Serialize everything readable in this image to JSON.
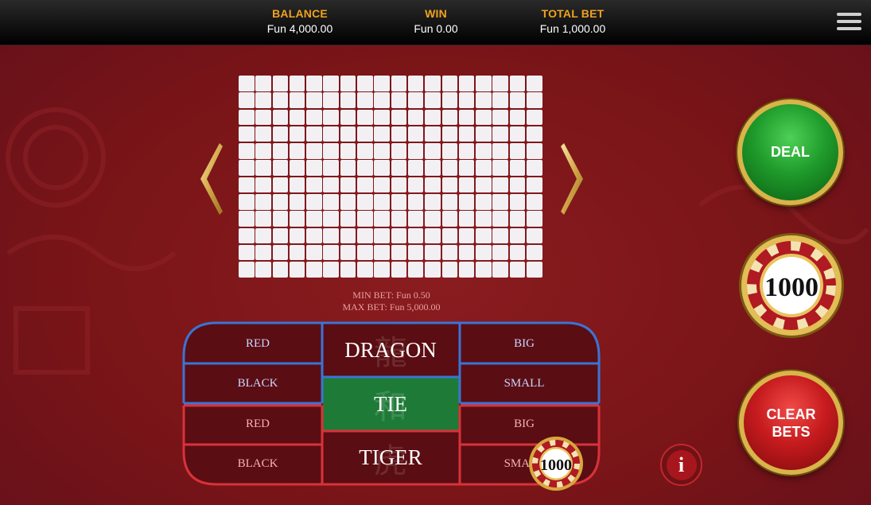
{
  "header": {
    "balance_label": "BALANCE",
    "balance_value": "Fun 4,000.00",
    "win_label": "WIN",
    "win_value": "Fun 0.00",
    "total_bet_label": "TOTAL BET",
    "total_bet_value": "Fun 1,000.00"
  },
  "roadmap": {
    "columns": 18,
    "rows": 12
  },
  "limits": {
    "min_bet": "MIN BET: Fun 0.50",
    "max_bet": "MAX BET: Fun 5,000.00"
  },
  "table": {
    "dragon_red": "RED",
    "dragon_black": "BLACK",
    "dragon_big": "BIG",
    "dragon_small": "SMALL",
    "tiger_red": "RED",
    "tiger_black": "BLACK",
    "tiger_big": "BIG",
    "tiger_small": "SMALL",
    "dragon": "DRAGON",
    "tie": "TIE",
    "tiger": "TIGER",
    "dragon_glyph": "龍",
    "tie_glyph": "和",
    "tiger_glyph": "虎"
  },
  "buttons": {
    "deal": "DEAL",
    "clear_line1": "CLEAR",
    "clear_line2": "BETS",
    "info": "i"
  },
  "chips": {
    "selected_value": "1000",
    "placed_value": "1000"
  },
  "colors": {
    "dragon_blue": "#3a74d6",
    "tiger_red": "#d8323a",
    "tie_green": "#1f7a36",
    "accent_gold": "#f0a21c"
  }
}
